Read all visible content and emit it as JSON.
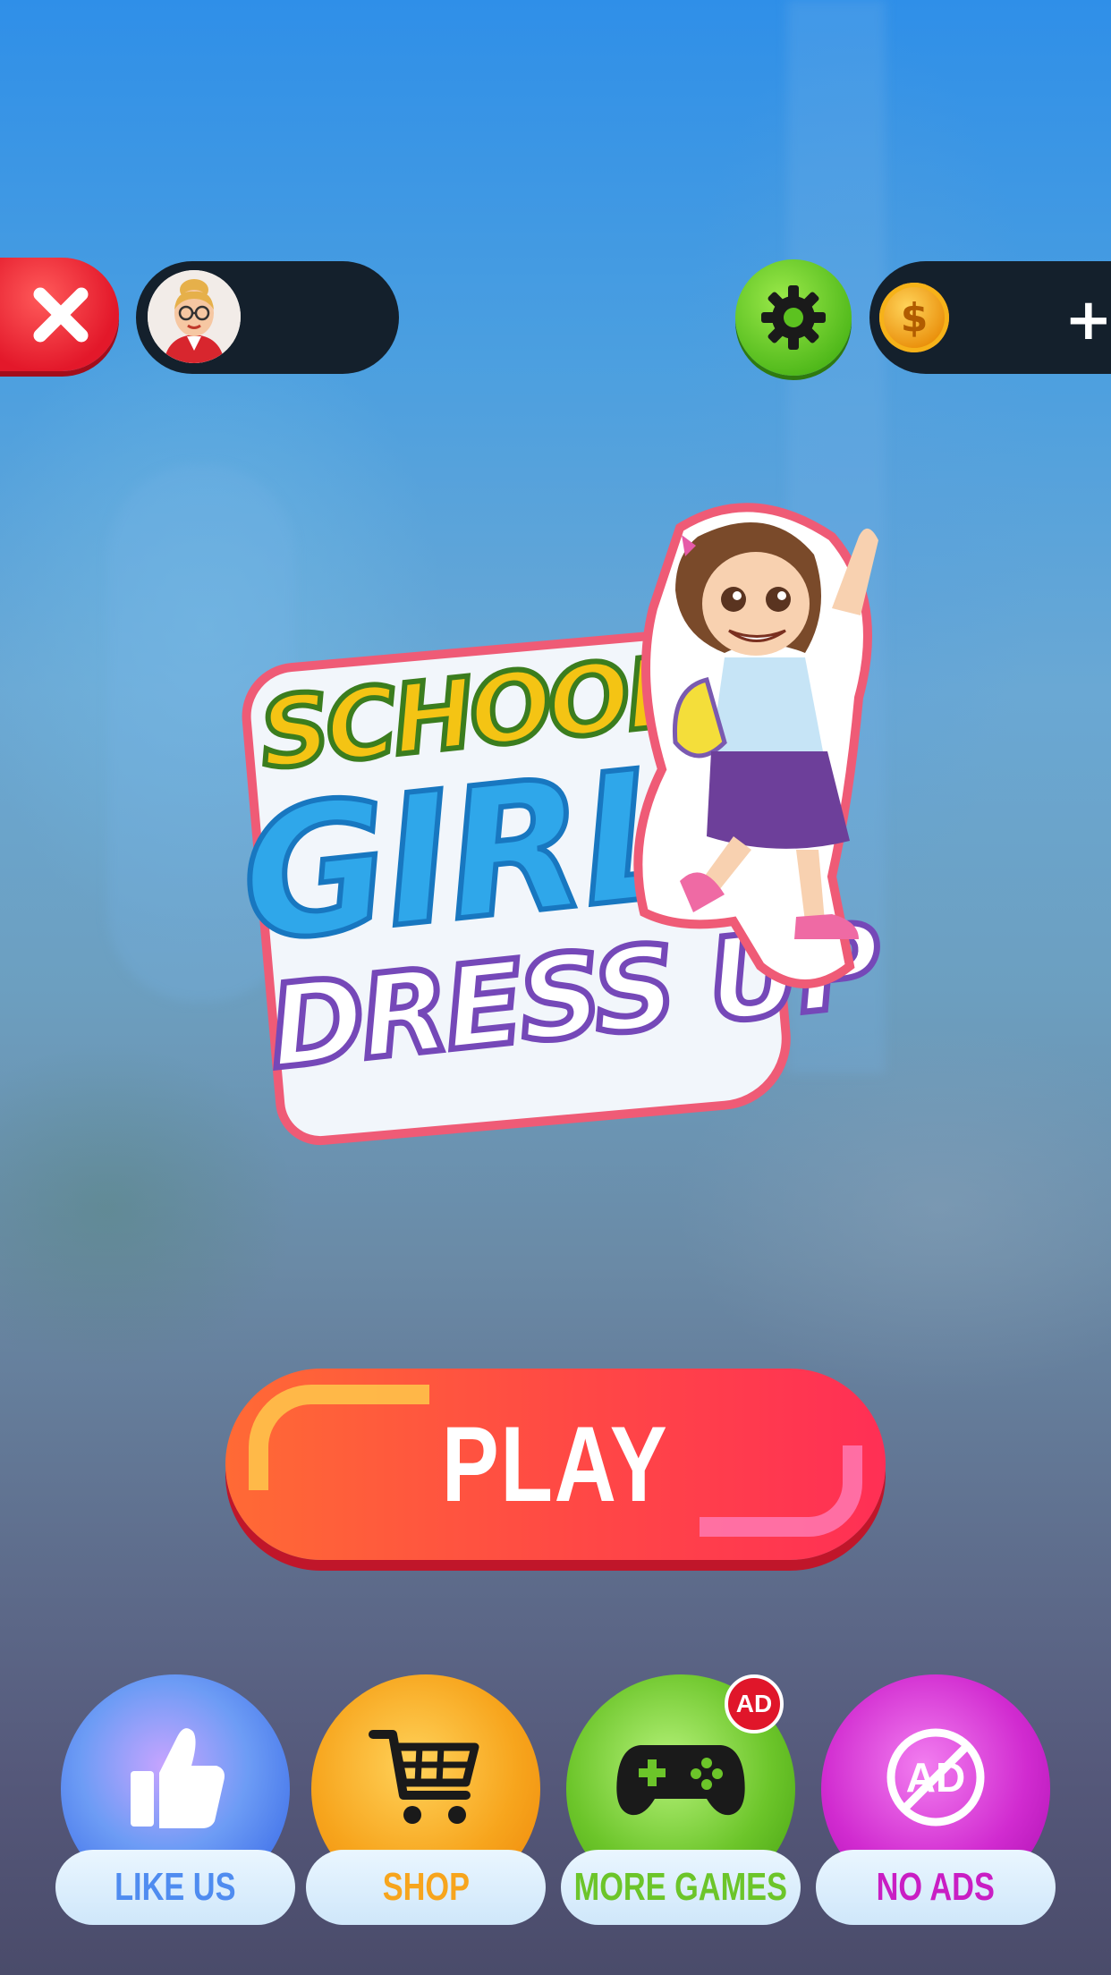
{
  "game_title": {
    "line1": "SCHOOL",
    "line2": "GIRL",
    "line3": "DRESS UP"
  },
  "play_button": {
    "label": "PLAY",
    "color": "#ff4a44"
  },
  "bottom_menu": {
    "items": [
      {
        "label": "LIKE US",
        "icon": "thumbs-up-icon",
        "color": "#4f8cf0"
      },
      {
        "label": "SHOP",
        "icon": "shopping-cart-icon",
        "color": "#f7a51d"
      },
      {
        "label": "MORE GAMES",
        "icon": "gamepad-icon",
        "color": "#6cc52a",
        "badge": "AD"
      },
      {
        "label": "NO ADS",
        "icon": "no-ads-icon",
        "color": "#c91ec4"
      }
    ]
  },
  "top_bar": {
    "close_icon": "close-icon",
    "settings_icon": "gear-icon",
    "coin_icon": "coin-icon",
    "coin_symbol": "$",
    "add_coins_label": "+"
  },
  "colors": {
    "close": "#e3182a",
    "settings": "#4fb81a",
    "pill": "#14202c"
  }
}
